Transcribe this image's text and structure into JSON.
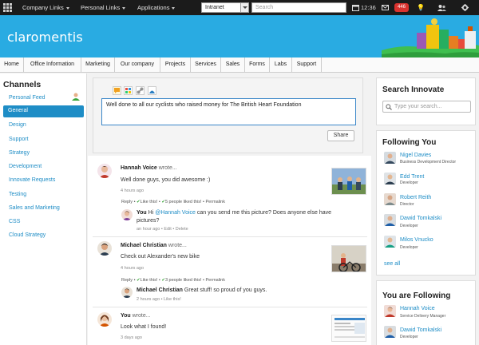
{
  "topbar": {
    "menus": [
      "Company Links",
      "Personal Links",
      "Applications"
    ],
    "selector_value": "Intranet",
    "search_placeholder": "Search",
    "time": "12:36",
    "badge": "446"
  },
  "header": {
    "logo": "claromentis"
  },
  "nav": {
    "tabs": [
      "Home",
      "Office Information",
      "Marketing",
      "Our company",
      "Projects",
      "Services",
      "Sales",
      "Forms",
      "Labs",
      "Support"
    ]
  },
  "channels": {
    "title": "Channels",
    "items": [
      "Personal Feed",
      "General",
      "Design",
      "Support",
      "Strategy",
      "Development",
      "Innovate Requests",
      "Testing",
      "Sales and Marketing",
      "CSS",
      "Cloud Strategy"
    ],
    "active": "General"
  },
  "composer": {
    "text": "Well done to all our cyclists who raised money for The British Heart Foundation",
    "share_label": "Share"
  },
  "feed": {
    "posts": [
      {
        "author": "Hannah Voice",
        "wrote": "wrote...",
        "message": "Well done guys, you did awesome :)",
        "time": "4 hours ago",
        "actions": {
          "reply": "Reply",
          "like": "Like this!",
          "likes": "5 people liked this!",
          "permalink": "Permalink"
        },
        "reply": {
          "author": "You",
          "prefix": "Hi",
          "mention": "@Hannah Voice",
          "text": "can you send me this picture? Does anyone else have pictures?",
          "meta": "an hour ago • Edit • Delete"
        }
      },
      {
        "author": "Michael Christian",
        "wrote": "wrote...",
        "message": "Check out Alexander's new bike",
        "time": "4 hours ago",
        "actions": {
          "reply": "Reply",
          "like": "Like this!",
          "likes": "3 people liked this!",
          "permalink": "Permalink"
        },
        "reply": {
          "author": "Michael Christian",
          "text": "Great stuff! so proud of you guys.",
          "meta": "2 hours ago • Like this!"
        }
      },
      {
        "author": "You",
        "wrote": "wrote...",
        "message": "Look what I found!",
        "time": "3 days ago"
      }
    ]
  },
  "search_panel": {
    "title": "Search Innovate",
    "placeholder": "Type your search..."
  },
  "following_you": {
    "title": "Following You",
    "people": [
      {
        "name": "Nigel Davies",
        "role": "Business Development Director"
      },
      {
        "name": "Edd Trent",
        "role": "Developer"
      },
      {
        "name": "Robert Reith",
        "role": "Director"
      },
      {
        "name": "Dawid Tomkalski",
        "role": "Developer"
      },
      {
        "name": "Milos Vnucko",
        "role": "Developer"
      }
    ],
    "see_all": "see all"
  },
  "you_follow": {
    "title": "You are Following",
    "people": [
      {
        "name": "Hannah Voice",
        "role": "Service Delivery Manager"
      },
      {
        "name": "Dawid Tomkalski",
        "role": "Developer"
      }
    ]
  },
  "colors": {
    "brand_blue": "#29abe2",
    "link_blue": "#1e8dc6",
    "topbar": "#1b1b1b",
    "badge_red": "#d9322e"
  }
}
